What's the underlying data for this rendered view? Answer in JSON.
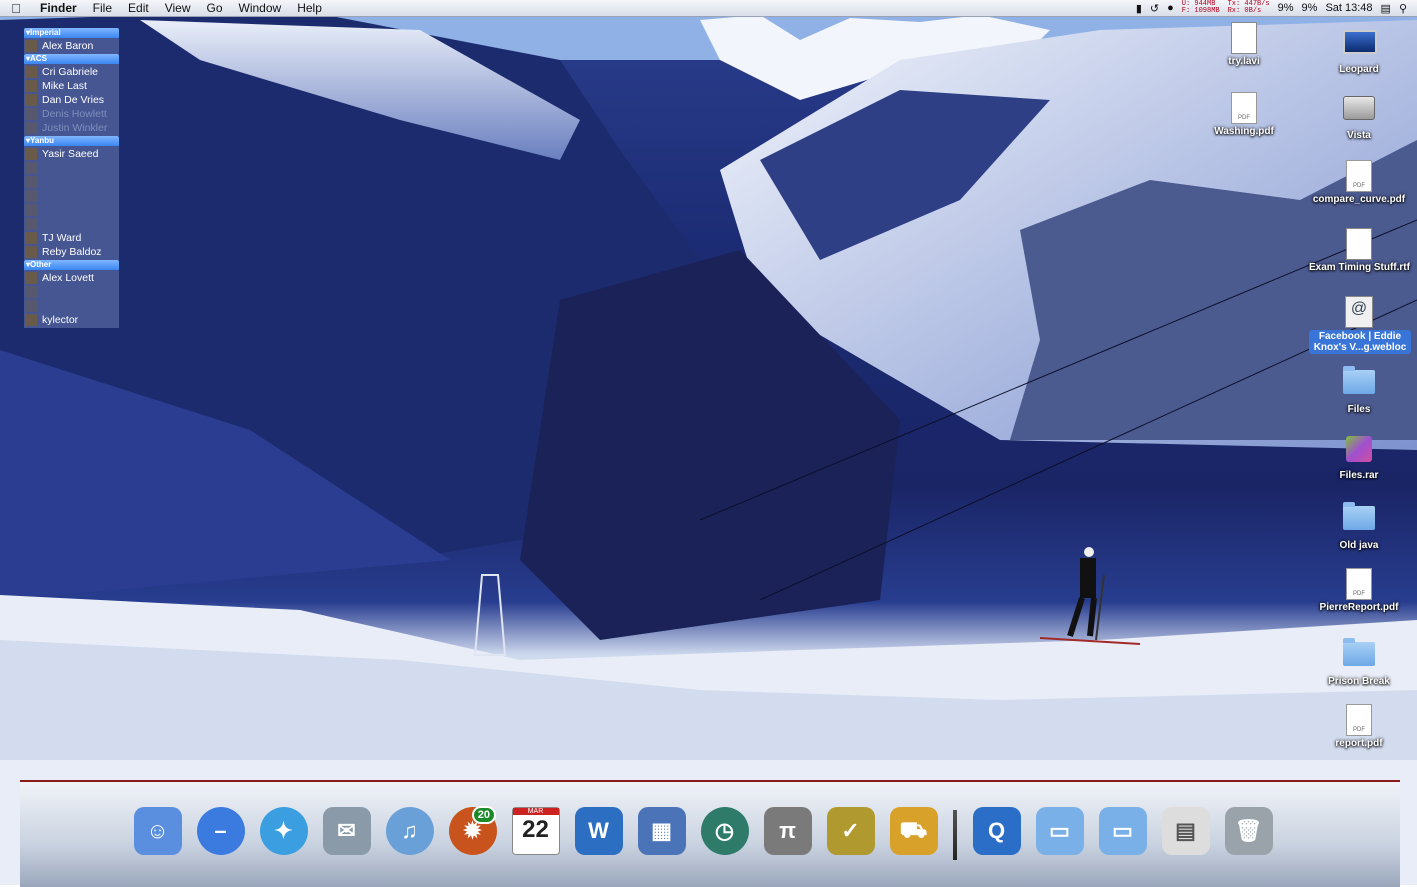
{
  "menubar": {
    "apple_icon": "apple-logo-icon",
    "app_name": "Finder",
    "menus": [
      "File",
      "Edit",
      "View",
      "Go",
      "Window",
      "Help"
    ],
    "status": {
      "net_u": "U: 944MB",
      "net_f": "F: 1098MB",
      "net_tx": "Tx: 447B/s",
      "net_rx": "Rx: 0B/s",
      "cpu1": "9%",
      "cpu2": "9%",
      "clock": "Sat 13:48"
    }
  },
  "buddy_list": {
    "groups": [
      {
        "name": "Imperial",
        "buddies": [
          {
            "name": "Alex Baron",
            "idle": false
          }
        ]
      },
      {
        "name": "ACS",
        "buddies": [
          {
            "name": "Cri Gabriele",
            "idle": false
          },
          {
            "name": "Mike Last",
            "idle": false
          },
          {
            "name": "Dan De Vries",
            "idle": false
          },
          {
            "name": "Denis Howlett",
            "idle": true
          },
          {
            "name": "Justin Winkler",
            "idle": true
          }
        ]
      },
      {
        "name": "Yanbu",
        "buddies": [
          {
            "name": "Yasir Saeed",
            "idle": false
          },
          {
            "name": "",
            "idle": true
          },
          {
            "name": "",
            "idle": true
          },
          {
            "name": "",
            "idle": true
          },
          {
            "name": "",
            "idle": true
          },
          {
            "name": "",
            "idle": true
          },
          {
            "name": "TJ Ward",
            "idle": false
          },
          {
            "name": "Reby Baldoz",
            "idle": false
          }
        ]
      },
      {
        "name": "Other",
        "buddies": [
          {
            "name": "Alex Lovett",
            "idle": false
          },
          {
            "name": "",
            "idle": true
          },
          {
            "name": "",
            "idle": true
          },
          {
            "name": "kylector",
            "idle": false
          }
        ]
      }
    ]
  },
  "desktop_icons": [
    {
      "label": "Leopard",
      "icon": "laptop-hd-icon"
    },
    {
      "label": "Vista",
      "icon": "hard-drive-icon"
    },
    {
      "label": "compare_curve.pdf",
      "icon": "pdf-file-icon"
    },
    {
      "label": "Exam Timing Stuff.rtf",
      "icon": "document-icon"
    },
    {
      "label": "Facebook | Eddie Knox's V...g.webloc",
      "icon": "webloc-file-icon",
      "selected": true
    },
    {
      "label": "Files",
      "icon": "folder-icon"
    },
    {
      "label": "Files.rar",
      "icon": "rar-archive-icon"
    },
    {
      "label": "Old java",
      "icon": "folder-icon"
    },
    {
      "label": "PierreReport.pdf",
      "icon": "pdf-file-icon"
    },
    {
      "label": "Prison Break",
      "icon": "folder-icon"
    },
    {
      "label": "report.pdf",
      "icon": "pdf-file-icon"
    },
    {
      "label": "try.lavi",
      "icon": "document-icon"
    },
    {
      "label": "Washing.pdf",
      "icon": "pdf-file-icon"
    }
  ],
  "dock": {
    "items": [
      {
        "name": "finder",
        "icon": "finder-icon",
        "color": "#5a8fe0"
      },
      {
        "name": "adium",
        "icon": "chat-bubble-icon",
        "color": "#3b7be0"
      },
      {
        "name": "safari",
        "icon": "compass-icon",
        "color": "#3a9ee0"
      },
      {
        "name": "mail",
        "icon": "mail-stamp-icon",
        "color": "#8b9aa8"
      },
      {
        "name": "itunes",
        "icon": "music-note-icon",
        "color": "#6aa0d8"
      },
      {
        "name": "firefox",
        "icon": "firefox-icon",
        "color": "#c8531c",
        "badge": "20"
      },
      {
        "name": "ical",
        "icon": "calendar-icon",
        "month": "MAR",
        "day": "22"
      },
      {
        "name": "wordpress",
        "icon": "w-logo-icon",
        "color": "#2b6ec2"
      },
      {
        "name": "calculator-widget",
        "icon": "phone-calc-icon",
        "color": "#4a73b8"
      },
      {
        "name": "time-machine",
        "icon": "clock-icon",
        "color": "#2e7b6a"
      },
      {
        "name": "latex",
        "icon": "latex-icon",
        "color": "#7a7a7a"
      },
      {
        "name": "tasks",
        "icon": "checkmark-icon",
        "color": "#b09a30"
      },
      {
        "name": "transmit",
        "icon": "truck-icon",
        "color": "#d7a12a"
      },
      {
        "name": "quicktime-mpeg",
        "icon": "mpeg-file-icon",
        "color": "#2a6ec8"
      },
      {
        "name": "documents-stack",
        "icon": "folder-stack-icon",
        "color": "#7ab0e8"
      },
      {
        "name": "downloads-stack",
        "icon": "folder-stack-icon",
        "color": "#7ab0e8"
      },
      {
        "name": "calendar-doc",
        "icon": "document-icon",
        "color": "#dddddd"
      },
      {
        "name": "trash",
        "icon": "trash-icon",
        "color": "#9aa3aa"
      }
    ]
  }
}
